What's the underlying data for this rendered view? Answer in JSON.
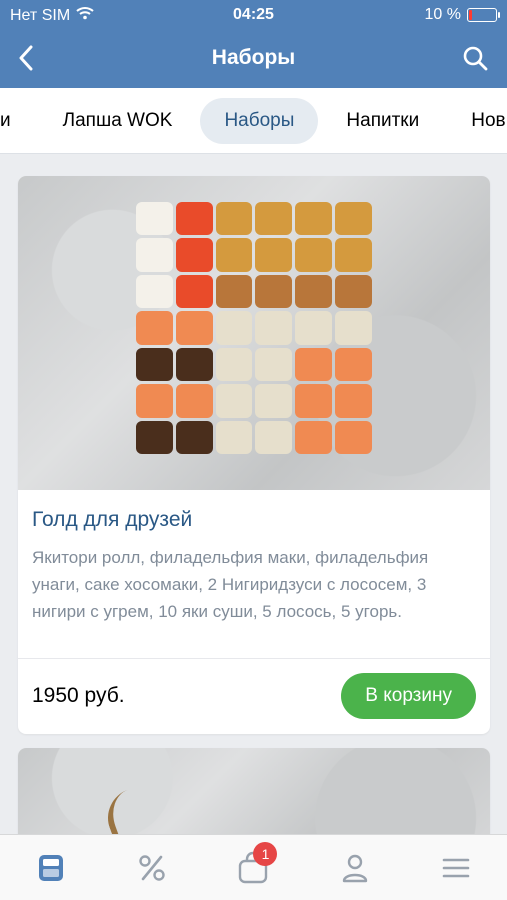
{
  "status_bar": {
    "carrier": "Нет SIM",
    "time": "04:25",
    "battery_percent": "10 %",
    "battery_level": 0.1
  },
  "nav": {
    "title": "Наборы",
    "back_icon": "chevron-left-icon",
    "search_icon": "search-icon"
  },
  "categories": {
    "items": [
      {
        "label": "и"
      },
      {
        "label": "Лапша WOK"
      },
      {
        "label": "Наборы",
        "active": true
      },
      {
        "label": "Напитки"
      },
      {
        "label": "Нов"
      }
    ]
  },
  "products": [
    {
      "title": "Голд для друзей",
      "description": "Якитори ролл, филадельфия маки, филадельфия унаги, саке хосомаки, 2 Нигиридзуси с лососем, 3 нигири с угрем, 10 яки суши, 5 лосось, 5 угорь.",
      "price": "1950 руб.",
      "cart_label": "В корзину"
    }
  ],
  "bottom_bar": {
    "items": [
      {
        "icon": "menu-card-icon",
        "active": true
      },
      {
        "icon": "percent-icon"
      },
      {
        "icon": "cart-bag-icon",
        "badge": "1"
      },
      {
        "icon": "profile-icon"
      },
      {
        "icon": "hamburger-menu-icon"
      }
    ]
  },
  "colors": {
    "header_bg": "#5181b8",
    "accent": "#2a5885",
    "button_green": "#4bb34b",
    "badge_red": "#e64646",
    "active_tab_bg": "#e5ebf1"
  }
}
